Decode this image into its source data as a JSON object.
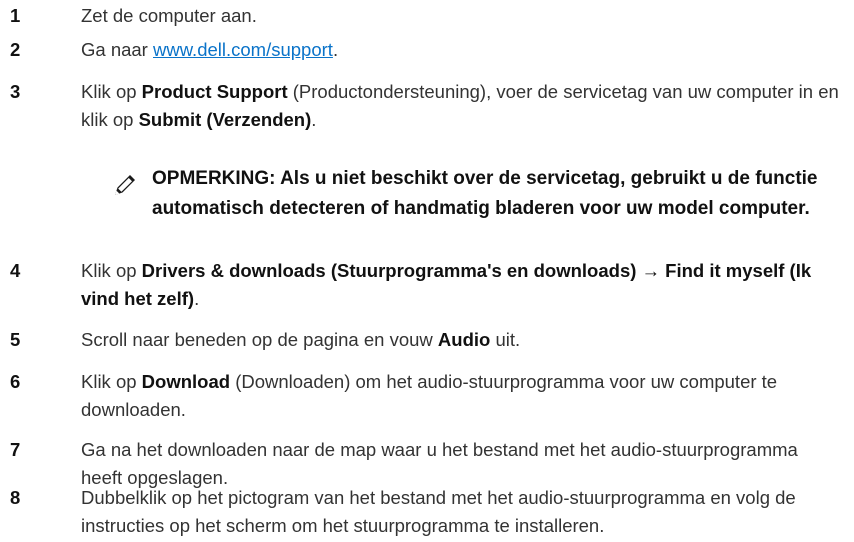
{
  "steps": [
    {
      "num": "1",
      "text": "Zet de computer aan."
    },
    {
      "num": "2",
      "prefix": "Ga naar ",
      "link": "www.dell.com/support",
      "suffix": "."
    },
    {
      "num": "3",
      "p1": "Klik op ",
      "b1": "Product Support",
      "p2": " (Productondersteuning), voer de servicetag van uw computer in en klik op ",
      "b2": "Submit (Verzenden)",
      "p3": "."
    },
    {
      "num": "4",
      "p1": "Klik op ",
      "b1": "Drivers & downloads (Stuurprogramma's en downloads) → Find it myself (Ik vind het zelf)",
      "p2": "."
    },
    {
      "num": "5",
      "p1": "Scroll naar beneden op de pagina en vouw ",
      "b1": "Audio",
      "p2": " uit."
    },
    {
      "num": "6",
      "p1": "Klik op ",
      "b1": "Download",
      "p2": " (Downloaden) om het audio-stuurprogramma voor uw computer te downloaden."
    },
    {
      "num": "7",
      "text": "Ga na het downloaden naar de map waar u het bestand met het audio-stuurprogramma heeft opgeslagen."
    },
    {
      "num": "8",
      "text": "Dubbelklik op het pictogram van het bestand met het audio-stuurprogramma en volg de instructies op het scherm om het stuurprogramma te installeren."
    }
  ],
  "note": {
    "icon": "note-pencil-icon",
    "text": "OPMERKING: Als u niet beschikt over de servicetag, gebruikt u de functie automatisch detecteren of handmatig bladeren voor uw model computer."
  }
}
